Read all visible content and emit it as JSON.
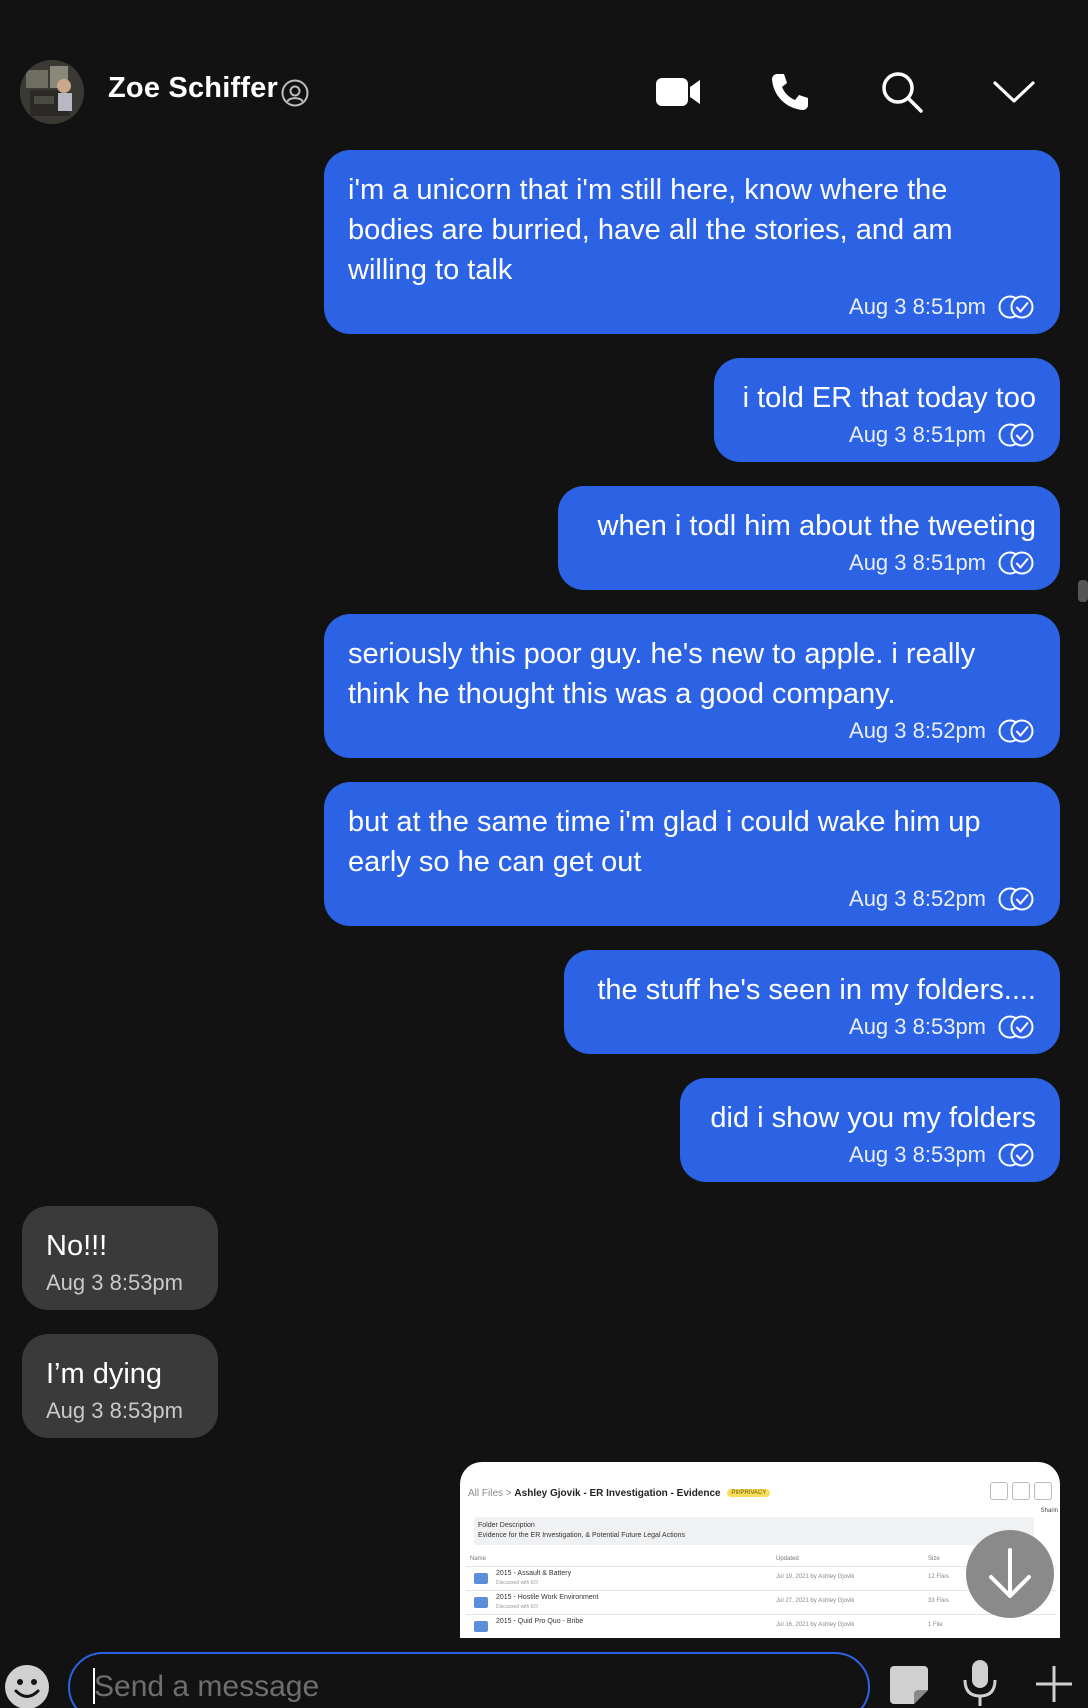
{
  "header": {
    "contact_name": "Zoe Schiffer",
    "icons": [
      "at-icon",
      "video-camera-icon",
      "phone-icon",
      "search-icon",
      "chevron-down-icon"
    ]
  },
  "messages": [
    {
      "direction": "outgoing",
      "text": "i'm a unicorn that i'm still here, know where the\nbodies are burried, have all the stories, and am\nwilling to talk",
      "time": "Aug 3 8:51pm",
      "status_icon": "read-check-icon"
    },
    {
      "direction": "outgoing",
      "text": "i told ER that today too",
      "time": "Aug 3 8:51pm",
      "status_icon": "read-check-icon"
    },
    {
      "direction": "outgoing",
      "text": "when i todl him about the tweeting",
      "time": "Aug 3 8:51pm",
      "status_icon": "read-check-icon"
    },
    {
      "direction": "outgoing",
      "text": "seriously this poor guy. he's new to apple. i really\nthink he thought this was a good company.",
      "time": "Aug 3 8:52pm",
      "status_icon": "read-check-icon"
    },
    {
      "direction": "outgoing",
      "text": "but at the same time i'm glad i could wake him up\nearly so he can get out",
      "time": "Aug 3 8:52pm",
      "status_icon": "read-check-icon"
    },
    {
      "direction": "outgoing",
      "text": "the stuff he's seen in my folders....",
      "time": "Aug 3 8:53pm",
      "status_icon": "read-check-icon"
    },
    {
      "direction": "outgoing",
      "text": "did i show you my folders",
      "time": "Aug 3 8:53pm",
      "status_icon": "read-check-icon"
    },
    {
      "direction": "incoming",
      "text": "No!!!",
      "time": "Aug 3 8:53pm"
    },
    {
      "direction": "incoming",
      "text": "I’m dying",
      "time": "Aug 3 8:53pm"
    }
  ],
  "attachment": {
    "breadcrumb_root": "All Files",
    "folder_title": "Ashley Gjovik - ER Investigation - Evidence",
    "tag": "PII/PRIVACY",
    "description_label": "Folder Description",
    "description": "Evidence for the ER Investigation, & Potential Future Legal Actions",
    "columns": [
      "Name",
      "Updated",
      "Size"
    ],
    "side_label": "Sharin",
    "rows": [
      {
        "name": "2015 - Assault & Battery",
        "note": "Discussed with EO",
        "updated": "Jul 19, 2021 by Ashley Gjovik",
        "size": "12 Files"
      },
      {
        "name": "2015 - Hostile Work Environment",
        "note": "Discussed with EO",
        "updated": "Jul 27, 2021 by Ashley Gjovik",
        "size": "33 Files"
      },
      {
        "name": "2015 - Quid Pro Quo - Bribe",
        "note": "",
        "updated": "Jul 16, 2021 by Ashley Gjovik",
        "size": "1 File"
      }
    ]
  },
  "composer": {
    "placeholder": "Send a message",
    "icons": [
      "emoji-icon",
      "sticker-icon",
      "microphone-icon",
      "plus-icon"
    ]
  },
  "colors": {
    "background": "#121212",
    "outgoing_bubble": "#2c63e5",
    "incoming_bubble": "#3a3a3a",
    "input_border": "#2c63e5"
  }
}
